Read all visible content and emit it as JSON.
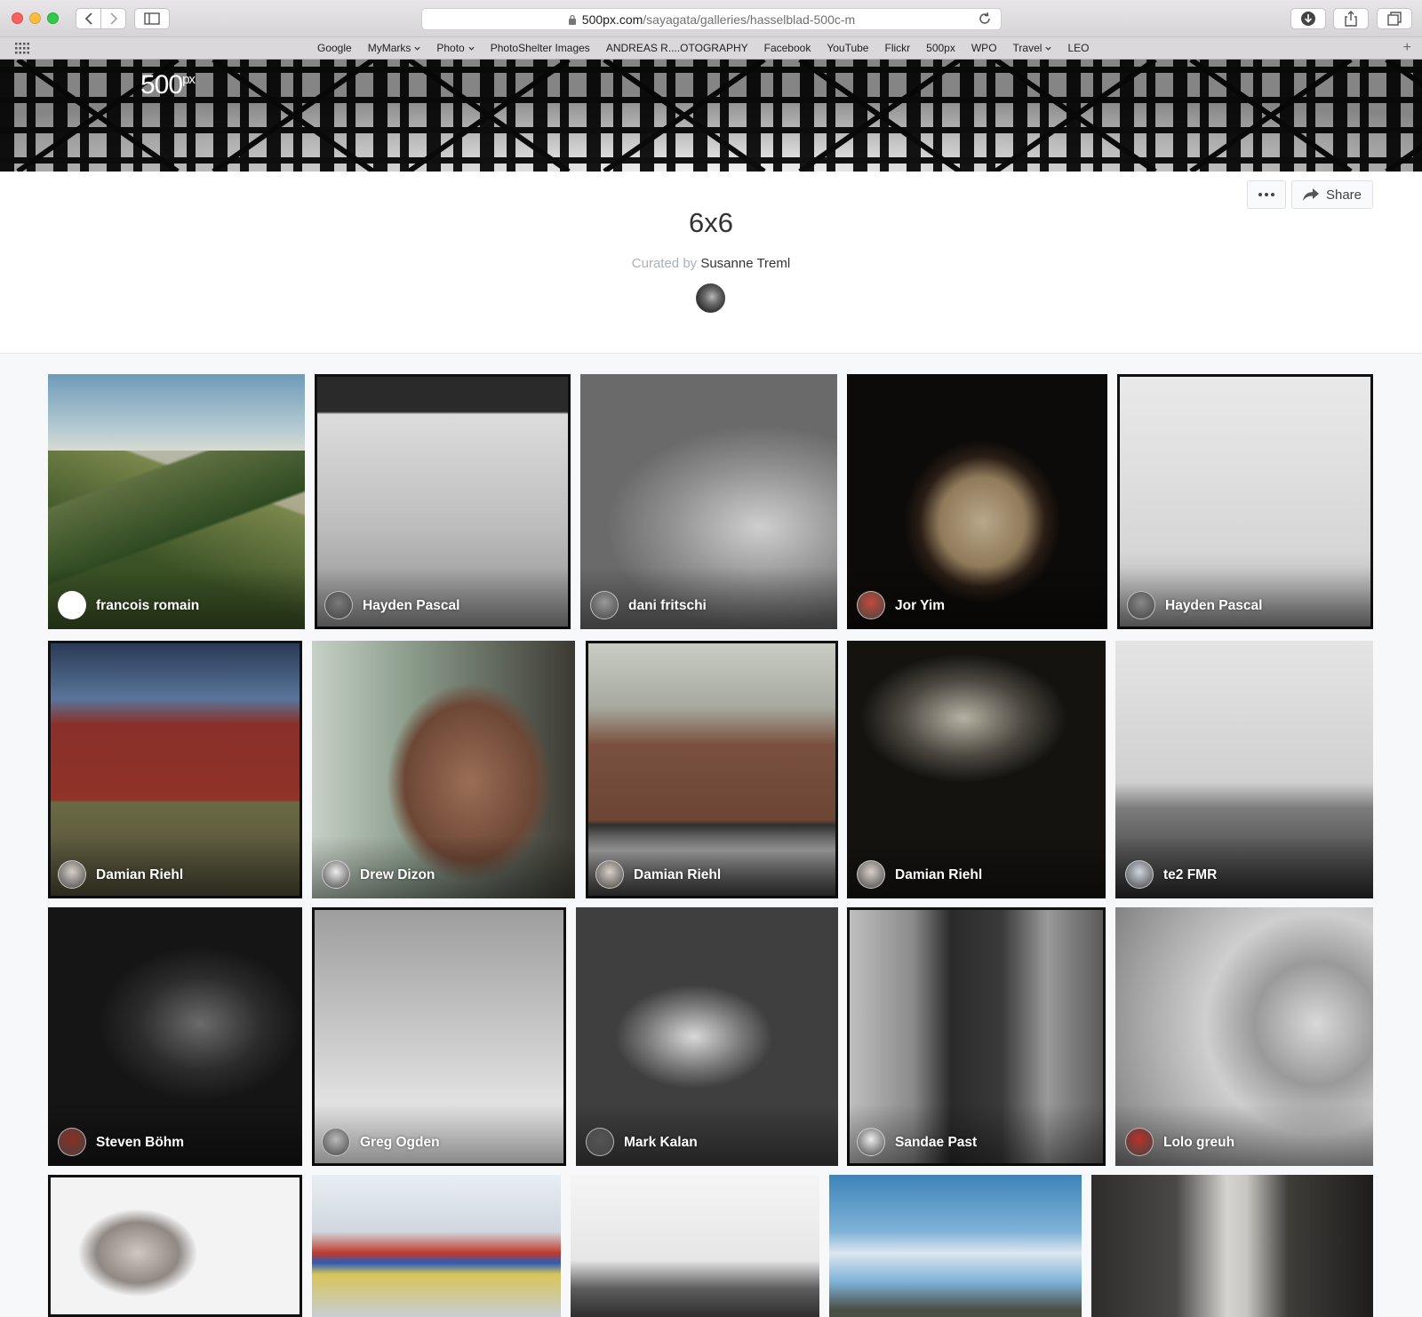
{
  "browser": {
    "url_host": "500px.com",
    "url_path": "/sayagata/galleries/hasselblad-500c-m",
    "bookmarks": [
      {
        "label": "Google",
        "menu": false
      },
      {
        "label": "MyMarks",
        "menu": true
      },
      {
        "label": "Photo",
        "menu": true
      },
      {
        "label": "PhotoShelter Images",
        "menu": false
      },
      {
        "label": "ANDREAS R....OTOGRAPHY",
        "menu": false
      },
      {
        "label": "Facebook",
        "menu": false
      },
      {
        "label": "YouTube",
        "menu": false
      },
      {
        "label": "Flickr",
        "menu": false
      },
      {
        "label": "500px",
        "menu": false
      },
      {
        "label": "WPO",
        "menu": false
      },
      {
        "label": "Travel",
        "menu": true
      },
      {
        "label": "LEO",
        "menu": false
      }
    ],
    "icons": [
      "back-icon",
      "forward-icon",
      "sidebar-icon",
      "lock-icon",
      "reload-icon",
      "download-icon",
      "share-icon",
      "tabs-icon",
      "apps-grid-icon",
      "plus-icon"
    ]
  },
  "site": {
    "logo": "500",
    "logo_sup": "px"
  },
  "gallery": {
    "title": "6x6",
    "curated_label": "Curated by",
    "curator": "Susanne Treml",
    "share_label": "Share",
    "more_icon": "ellipsis-icon"
  },
  "photos": [
    {
      "author": "francois romain",
      "theme": "mountain"
    },
    {
      "author": "Hayden Pascal",
      "theme": "bw-street"
    },
    {
      "author": "dani fritschi",
      "theme": "bw-rocks"
    },
    {
      "author": "Jor Yim",
      "theme": "cat-window"
    },
    {
      "author": "Hayden Pascal",
      "theme": "bw-lamp"
    },
    {
      "author": "Damian Riehl",
      "theme": "green-car"
    },
    {
      "author": "Drew Dizon",
      "theme": "woman-back"
    },
    {
      "author": "Damian Riehl",
      "theme": "rusty-car"
    },
    {
      "author": "Damian Riehl",
      "theme": "dark-interior"
    },
    {
      "author": "te2 FMR",
      "theme": "tracks"
    },
    {
      "author": "Steven Böhm",
      "theme": "dark-portrait"
    },
    {
      "author": "Greg Ogden",
      "theme": "trailer"
    },
    {
      "author": "Mark Kalan",
      "theme": "heel"
    },
    {
      "author": "Sandae Past",
      "theme": "girl-portrait"
    },
    {
      "author": "Lolo greuh",
      "theme": "dome"
    },
    {
      "author": "",
      "theme": "shaved-head"
    },
    {
      "author": "",
      "theme": "toy-train"
    },
    {
      "author": "",
      "theme": "ferris-wheel"
    },
    {
      "author": "",
      "theme": "sky"
    },
    {
      "author": "",
      "theme": "alley"
    }
  ],
  "colors": {
    "accent": "#a9b1ba",
    "page_bg": "#f7f8fa"
  }
}
